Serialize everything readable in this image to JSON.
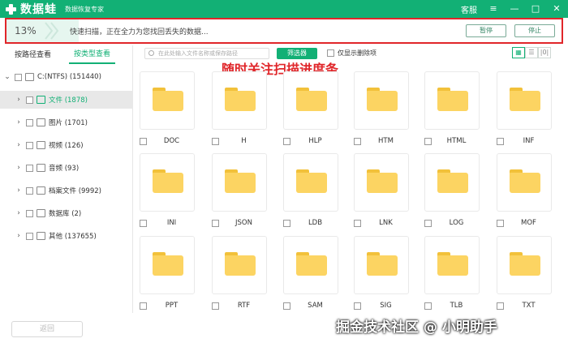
{
  "titlebar": {
    "app_name": "数据蛙",
    "subtitle": "数据恢复专家",
    "support": "客服",
    "menu_icon": "≡",
    "minimize_icon": "—",
    "maximize_icon": "□",
    "close_icon": "✕"
  },
  "progress": {
    "percent": "13%",
    "fill_fraction": 0.13,
    "status": "快速扫描，正在全力为您找回丢失的数据...",
    "pause_label": "暂停",
    "stop_label": "停止"
  },
  "sidebar": {
    "tabs": [
      "按路径查看",
      "按类型查看"
    ],
    "active_tab": 1,
    "drive": "C:(NTFS) (151440)",
    "items": [
      {
        "label": "文件 (1878)",
        "selected": true
      },
      {
        "label": "图片 (1701)",
        "selected": false
      },
      {
        "label": "视频 (126)",
        "selected": false
      },
      {
        "label": "音频 (93)",
        "selected": false
      },
      {
        "label": "档案文件 (9992)",
        "selected": false
      },
      {
        "label": "数据库 (2)",
        "selected": false
      },
      {
        "label": "其他 (137655)",
        "selected": false
      }
    ]
  },
  "toolbar": {
    "search_placeholder": "在此处输入文件名称或保存路径",
    "filter_label": "筛选器",
    "only_deleted_label": "仅显示删除项",
    "view_grid": "▦",
    "view_list": "☰",
    "view_detail": "|0|"
  },
  "annotation": "随时关注扫描进度条",
  "folders": [
    "DOC",
    "H",
    "HLP",
    "HTM",
    "HTML",
    "INF",
    "INI",
    "JSON",
    "LDB",
    "LNK",
    "LOG",
    "MOF",
    "PPT",
    "RTF",
    "SAM",
    "SIG",
    "TLB",
    "TXT"
  ],
  "footer": {
    "back_label": "返回",
    "watermark": "掘金技术社区 @ 小明助手"
  },
  "colors": {
    "brand": "#12b075",
    "highlight": "#e0262a",
    "folder": "#fcd462"
  }
}
